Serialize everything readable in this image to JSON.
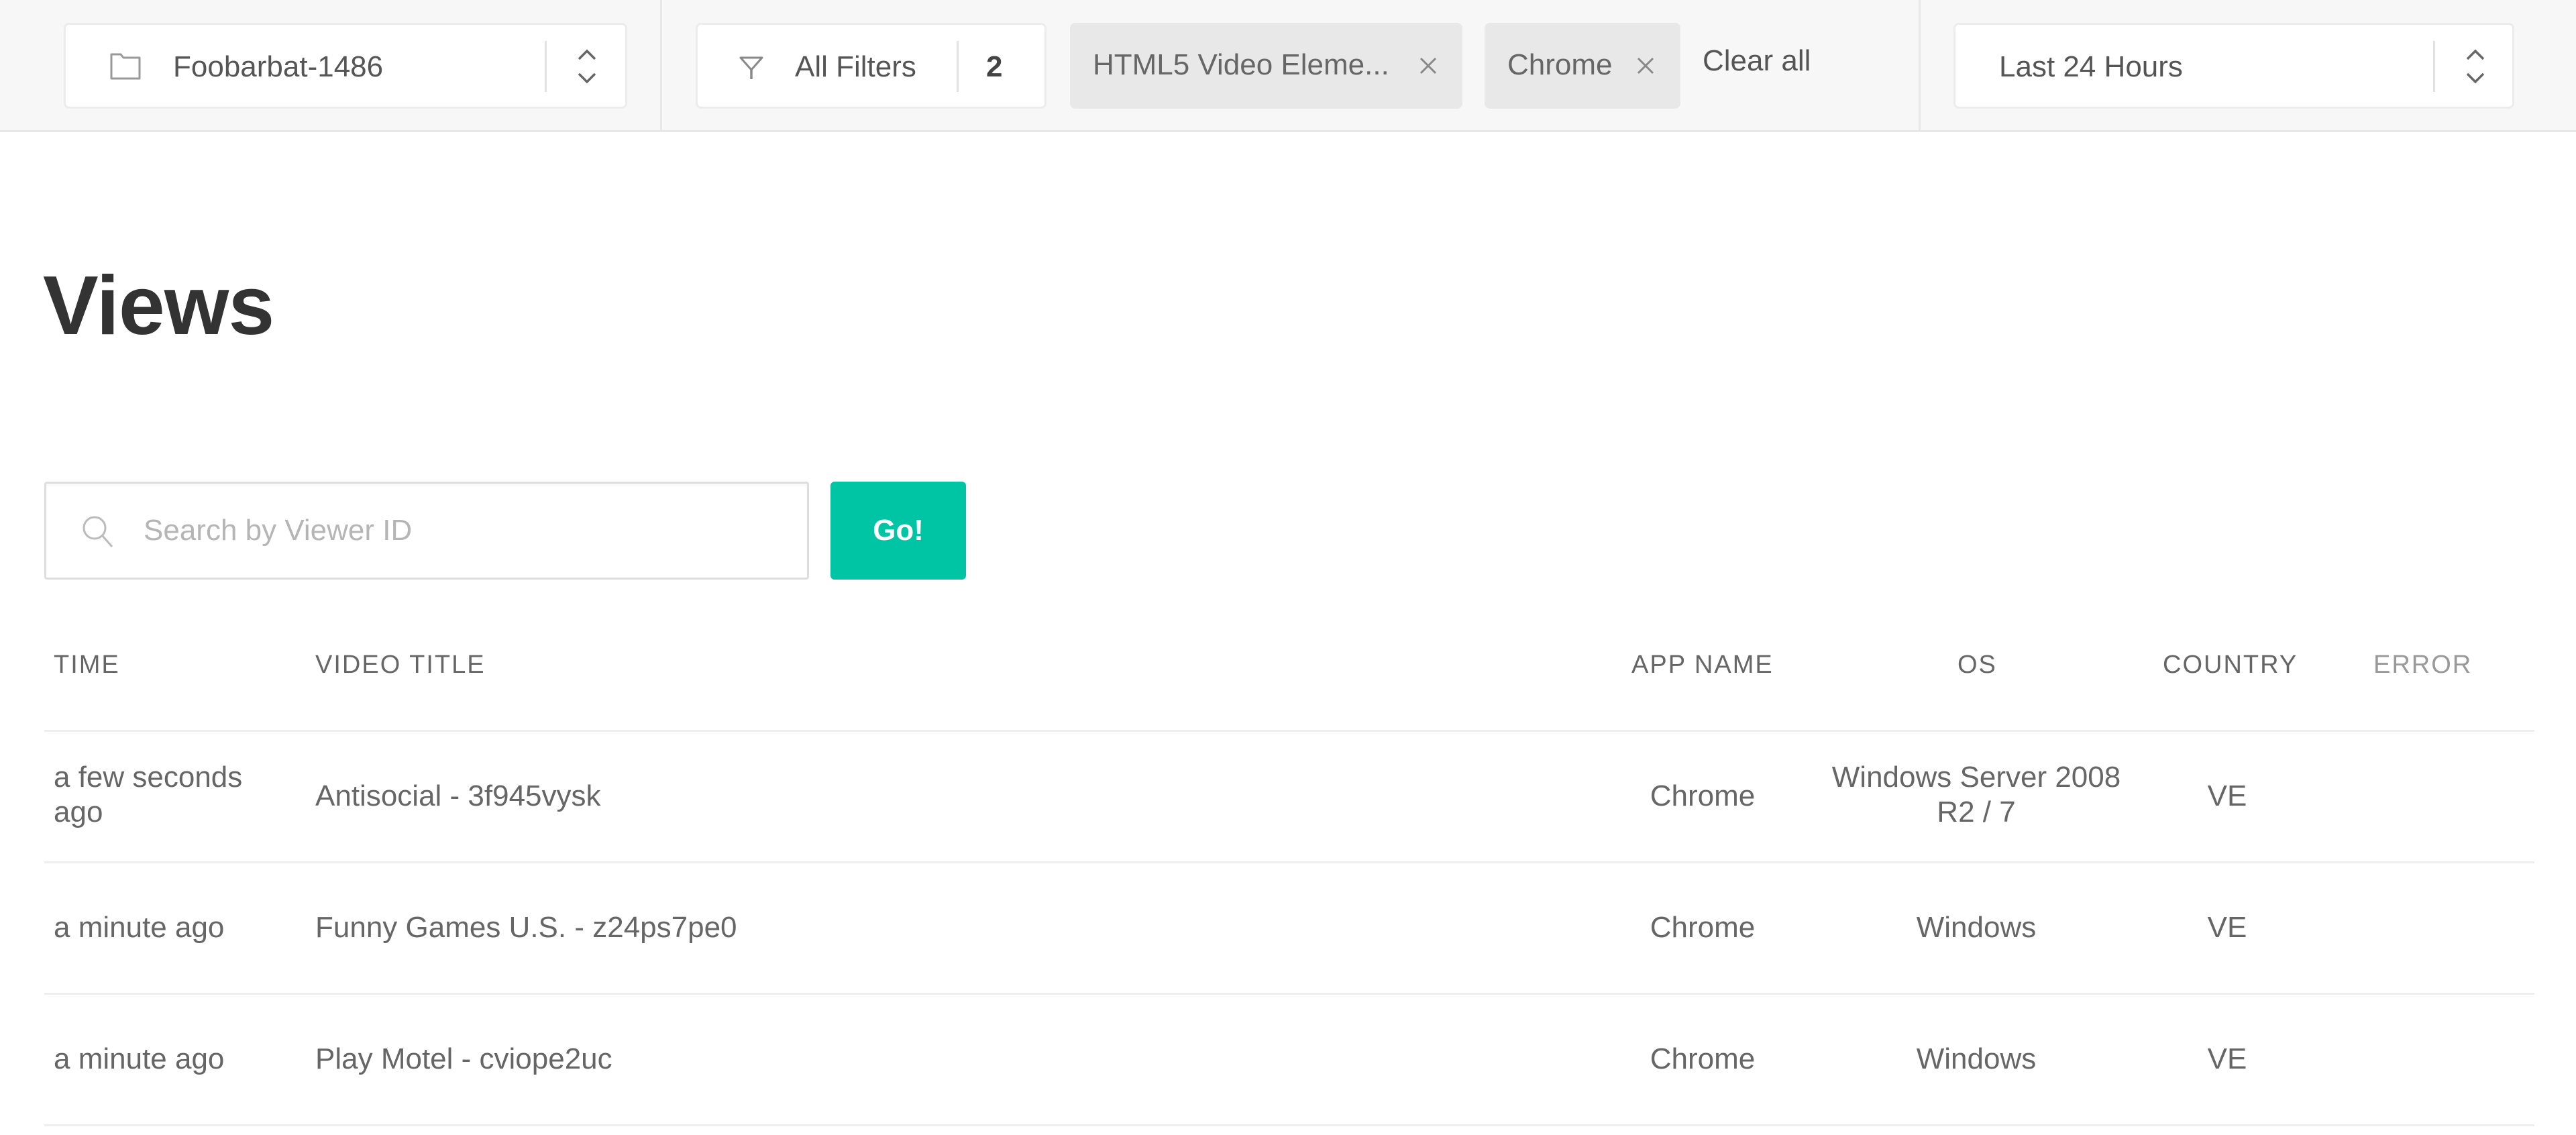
{
  "topbar": {
    "property_selector": {
      "icon": "folder-icon",
      "value": "Foobarbat-1486"
    },
    "filters": {
      "icon": "filter-icon",
      "label": "All Filters",
      "count": "2"
    },
    "active_filters": [
      {
        "label": "HTML5 Video Eleme...",
        "remove_icon": "close-icon"
      },
      {
        "label": "Chrome",
        "remove_icon": "close-icon"
      }
    ],
    "clear_all_label": "Clear all",
    "time_range": {
      "value": "Last 24 Hours"
    }
  },
  "page": {
    "title": "Views"
  },
  "search": {
    "placeholder": "Search by Viewer ID",
    "value": "",
    "icon": "search-icon",
    "go_label": "Go!"
  },
  "colors": {
    "accent": "#00c5a4",
    "chip_bg": "#e8e8e8",
    "topbar_bg": "#f7f7f7",
    "title": "#333333"
  },
  "table": {
    "columns": [
      "TIME",
      "VIDEO TITLE",
      "APP NAME",
      "OS",
      "COUNTRY",
      "ERROR"
    ],
    "rows": [
      {
        "time": "a few seconds ago",
        "video_title": "Antisocial - 3f945vysk",
        "app_name": "Chrome",
        "os": "Windows Server 2008 R2 / 7",
        "country": "VE",
        "error": ""
      },
      {
        "time": "a minute ago",
        "video_title": "Funny Games U.S. - z24ps7pe0",
        "app_name": "Chrome",
        "os": "Windows",
        "country": "VE",
        "error": ""
      },
      {
        "time": "a minute ago",
        "video_title": "Play Motel - cviope2uc",
        "app_name": "Chrome",
        "os": "Windows",
        "country": "VE",
        "error": ""
      }
    ]
  }
}
